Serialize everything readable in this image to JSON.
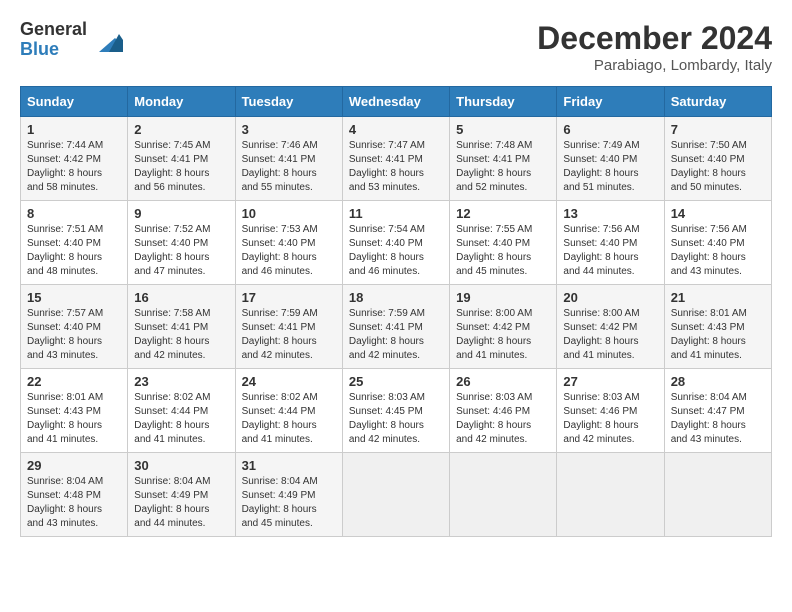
{
  "logo": {
    "general": "General",
    "blue": "Blue"
  },
  "title": "December 2024",
  "location": "Parabiago, Lombardy, Italy",
  "days_of_week": [
    "Sunday",
    "Monday",
    "Tuesday",
    "Wednesday",
    "Thursday",
    "Friday",
    "Saturday"
  ],
  "weeks": [
    [
      {
        "day": 1,
        "sunrise": "7:44 AM",
        "sunset": "4:42 PM",
        "daylight": "8 hours and 58 minutes."
      },
      {
        "day": 2,
        "sunrise": "7:45 AM",
        "sunset": "4:41 PM",
        "daylight": "8 hours and 56 minutes."
      },
      {
        "day": 3,
        "sunrise": "7:46 AM",
        "sunset": "4:41 PM",
        "daylight": "8 hours and 55 minutes."
      },
      {
        "day": 4,
        "sunrise": "7:47 AM",
        "sunset": "4:41 PM",
        "daylight": "8 hours and 53 minutes."
      },
      {
        "day": 5,
        "sunrise": "7:48 AM",
        "sunset": "4:41 PM",
        "daylight": "8 hours and 52 minutes."
      },
      {
        "day": 6,
        "sunrise": "7:49 AM",
        "sunset": "4:40 PM",
        "daylight": "8 hours and 51 minutes."
      },
      {
        "day": 7,
        "sunrise": "7:50 AM",
        "sunset": "4:40 PM",
        "daylight": "8 hours and 50 minutes."
      }
    ],
    [
      {
        "day": 8,
        "sunrise": "7:51 AM",
        "sunset": "4:40 PM",
        "daylight": "8 hours and 48 minutes."
      },
      {
        "day": 9,
        "sunrise": "7:52 AM",
        "sunset": "4:40 PM",
        "daylight": "8 hours and 47 minutes."
      },
      {
        "day": 10,
        "sunrise": "7:53 AM",
        "sunset": "4:40 PM",
        "daylight": "8 hours and 46 minutes."
      },
      {
        "day": 11,
        "sunrise": "7:54 AM",
        "sunset": "4:40 PM",
        "daylight": "8 hours and 46 minutes."
      },
      {
        "day": 12,
        "sunrise": "7:55 AM",
        "sunset": "4:40 PM",
        "daylight": "8 hours and 45 minutes."
      },
      {
        "day": 13,
        "sunrise": "7:56 AM",
        "sunset": "4:40 PM",
        "daylight": "8 hours and 44 minutes."
      },
      {
        "day": 14,
        "sunrise": "7:56 AM",
        "sunset": "4:40 PM",
        "daylight": "8 hours and 43 minutes."
      }
    ],
    [
      {
        "day": 15,
        "sunrise": "7:57 AM",
        "sunset": "4:40 PM",
        "daylight": "8 hours and 43 minutes."
      },
      {
        "day": 16,
        "sunrise": "7:58 AM",
        "sunset": "4:41 PM",
        "daylight": "8 hours and 42 minutes."
      },
      {
        "day": 17,
        "sunrise": "7:59 AM",
        "sunset": "4:41 PM",
        "daylight": "8 hours and 42 minutes."
      },
      {
        "day": 18,
        "sunrise": "7:59 AM",
        "sunset": "4:41 PM",
        "daylight": "8 hours and 42 minutes."
      },
      {
        "day": 19,
        "sunrise": "8:00 AM",
        "sunset": "4:42 PM",
        "daylight": "8 hours and 41 minutes."
      },
      {
        "day": 20,
        "sunrise": "8:00 AM",
        "sunset": "4:42 PM",
        "daylight": "8 hours and 41 minutes."
      },
      {
        "day": 21,
        "sunrise": "8:01 AM",
        "sunset": "4:43 PM",
        "daylight": "8 hours and 41 minutes."
      }
    ],
    [
      {
        "day": 22,
        "sunrise": "8:01 AM",
        "sunset": "4:43 PM",
        "daylight": "8 hours and 41 minutes."
      },
      {
        "day": 23,
        "sunrise": "8:02 AM",
        "sunset": "4:44 PM",
        "daylight": "8 hours and 41 minutes."
      },
      {
        "day": 24,
        "sunrise": "8:02 AM",
        "sunset": "4:44 PM",
        "daylight": "8 hours and 41 minutes."
      },
      {
        "day": 25,
        "sunrise": "8:03 AM",
        "sunset": "4:45 PM",
        "daylight": "8 hours and 42 minutes."
      },
      {
        "day": 26,
        "sunrise": "8:03 AM",
        "sunset": "4:46 PM",
        "daylight": "8 hours and 42 minutes."
      },
      {
        "day": 27,
        "sunrise": "8:03 AM",
        "sunset": "4:46 PM",
        "daylight": "8 hours and 42 minutes."
      },
      {
        "day": 28,
        "sunrise": "8:04 AM",
        "sunset": "4:47 PM",
        "daylight": "8 hours and 43 minutes."
      }
    ],
    [
      {
        "day": 29,
        "sunrise": "8:04 AM",
        "sunset": "4:48 PM",
        "daylight": "8 hours and 43 minutes."
      },
      {
        "day": 30,
        "sunrise": "8:04 AM",
        "sunset": "4:49 PM",
        "daylight": "8 hours and 44 minutes."
      },
      {
        "day": 31,
        "sunrise": "8:04 AM",
        "sunset": "4:49 PM",
        "daylight": "8 hours and 45 minutes."
      },
      null,
      null,
      null,
      null
    ]
  ],
  "labels": {
    "sunrise": "Sunrise:",
    "sunset": "Sunset:",
    "daylight": "Daylight:"
  }
}
